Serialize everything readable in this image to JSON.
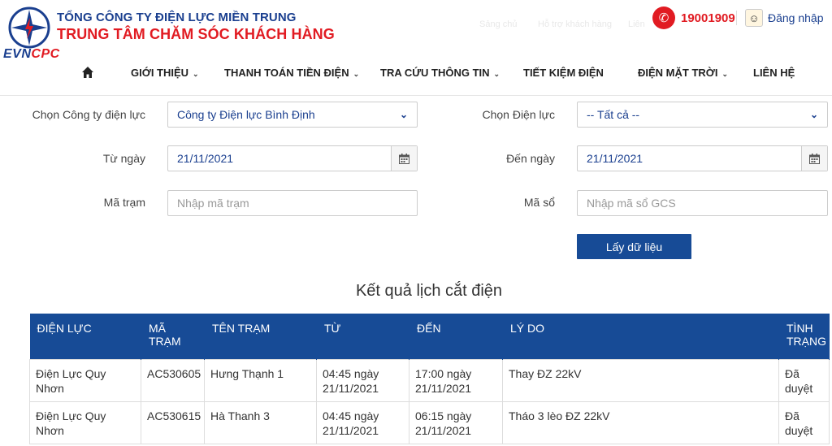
{
  "header": {
    "org_line1": "TỔNG CÔNG TY ĐIỆN LỰC MIỀN TRUNG",
    "org_line2": "TRUNG TÂM CHĂM SÓC KHÁCH HÀNG",
    "brand_evn": "EVN",
    "brand_cpc": "CPC",
    "faint_links": [
      "Sảng chủ",
      "Hỗ trợ khách hàng",
      "Liên"
    ],
    "hotline": "19001909",
    "login_label": "Đăng nhập"
  },
  "nav": {
    "items": [
      {
        "label": "GIỚI THIỆU",
        "has_caret": true
      },
      {
        "label": "THANH TOÁN TIỀN ĐIỆN",
        "has_caret": true
      },
      {
        "label": "TRA CỨU THÔNG TIN",
        "has_caret": true
      },
      {
        "label": "TIẾT KIỆM ĐIỆN",
        "has_caret": false
      },
      {
        "label": "ĐIỆN MẶT TRỜI",
        "has_caret": true
      },
      {
        "label": "LIÊN HỆ",
        "has_caret": false
      }
    ]
  },
  "form": {
    "company_label": "Chọn Công ty điện lực",
    "company_value": "Công ty Điện lực Bình Định",
    "dienluc_label": "Chọn Điện lực",
    "dienluc_value": "-- Tất cả --",
    "from_label": "Từ ngày",
    "from_value": "21/11/2021",
    "to_label": "Đến ngày",
    "to_value": "21/11/2021",
    "station_label": "Mã trạm",
    "station_placeholder": "Nhập mã trạm",
    "book_label": "Mã sổ",
    "book_placeholder": "Nhập mã sổ GCS",
    "submit_label": "Lấy dữ liệu"
  },
  "results": {
    "title": "Kết quả lịch cắt điện",
    "columns": [
      "ĐIỆN LỰC",
      "MÃ TRẠM",
      "TÊN TRẠM",
      "TỪ",
      "ĐẾN",
      "LÝ DO",
      "TÌNH TRẠNG"
    ],
    "rows": [
      {
        "dien_luc": "Điện Lực Quy Nhơn",
        "ma_tram": "AC530605",
        "ten_tram": "Hưng Thạnh 1",
        "tu": "04:45 ngày 21/11/2021",
        "den": "17:00 ngày 21/11/2021",
        "ly_do": "Thay ĐZ 22kV",
        "tinh_trang": "Đã duyệt"
      },
      {
        "dien_luc": "Điện Lực Quy Nhơn",
        "ma_tram": "AC530615",
        "ten_tram": "Hà Thanh 3",
        "tu": "04:45 ngày 21/11/2021",
        "den": "06:15 ngày 21/11/2021",
        "ly_do": "Tháo 3 lèo ĐZ 22kV",
        "tinh_trang": "Đã duyệt"
      }
    ]
  },
  "colors": {
    "brand_blue": "#174b96",
    "brand_red": "#e11b22"
  },
  "icons": [
    "evn-logo-icon",
    "phone-icon",
    "user-avatar-icon",
    "home-icon",
    "chevron-down-icon",
    "calendar-icon"
  ]
}
